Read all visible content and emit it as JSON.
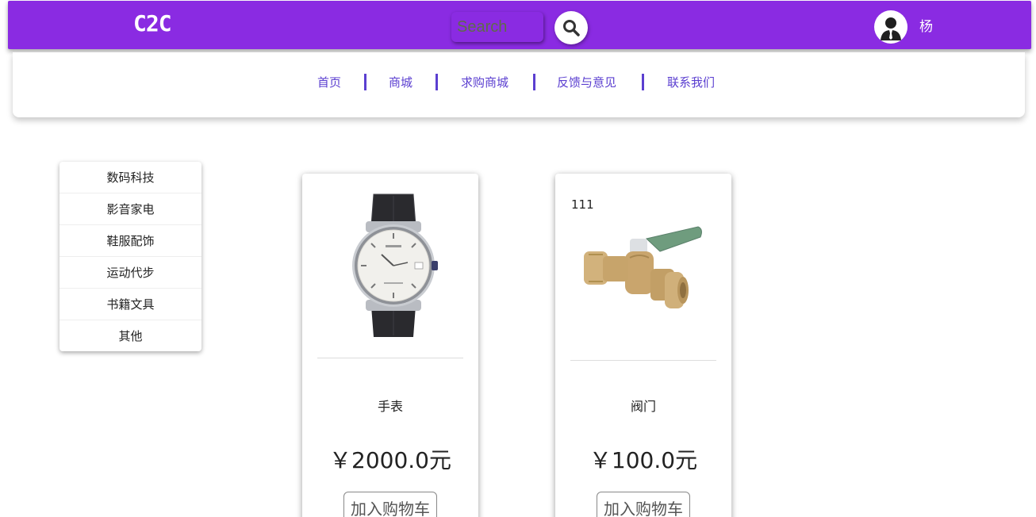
{
  "header": {
    "brand": "C2C",
    "search_placeholder": "Search",
    "search_icon": "search-icon",
    "avatar_icon": "user-avatar-icon",
    "username": "杨",
    "colors": {
      "bar": "#8a2be2",
      "text": "#ffffff"
    }
  },
  "nav": {
    "items": [
      {
        "label": "首页"
      },
      {
        "label": "商城"
      },
      {
        "label": "求购商城"
      },
      {
        "label": "反馈与意见"
      },
      {
        "label": "联系我们"
      }
    ],
    "color": "#5b3fd0"
  },
  "categories": [
    {
      "label": "数码科技"
    },
    {
      "label": "影音家电"
    },
    {
      "label": "鞋服配饰"
    },
    {
      "label": "运动代步"
    },
    {
      "label": "书籍文具"
    },
    {
      "label": "其他"
    }
  ],
  "products": [
    {
      "name": "手表",
      "price": "￥2000.0元",
      "button": "加入购物车",
      "image_caption": "",
      "image_icon": "watch-image"
    },
    {
      "name": "阀门",
      "price": "￥100.0元",
      "button": "加入购物车",
      "image_caption": "111",
      "image_icon": "valve-image"
    }
  ]
}
